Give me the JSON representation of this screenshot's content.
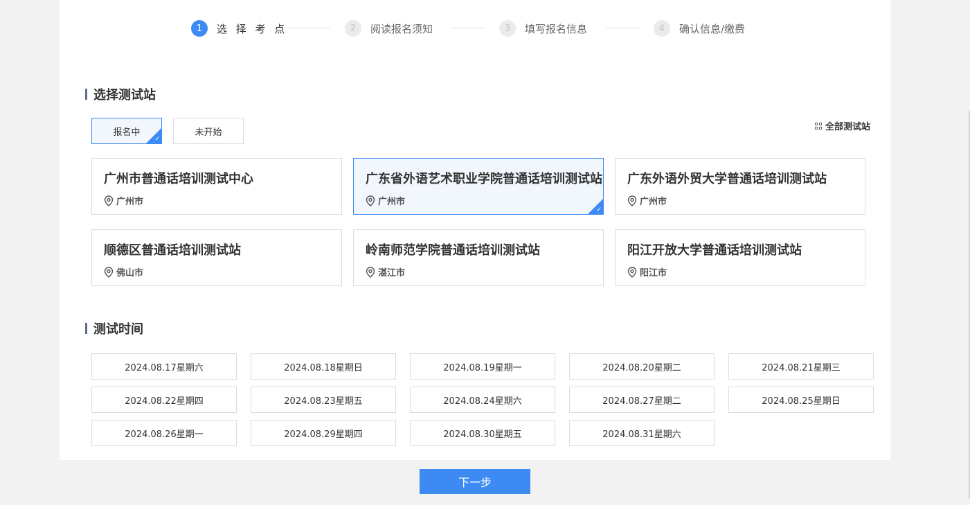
{
  "steps": [
    {
      "num": "1",
      "label": "选 择 考 点"
    },
    {
      "num": "2",
      "label": "阅读报名须知"
    },
    {
      "num": "3",
      "label": "填写报名信息"
    },
    {
      "num": "4",
      "label": "确认信息/缴费"
    }
  ],
  "site_section": {
    "title": "选择测试站",
    "filters": [
      "报名中",
      "未开始"
    ],
    "active_filter": "报名中",
    "all_sites_label": "全部测试站",
    "corner_check": "✓",
    "sites": [
      {
        "name": "广州市普通话培训测试中心",
        "city": "广州市"
      },
      {
        "name": "广东省外语艺术职业学院普通话培训测试站",
        "city": "广州市",
        "selected": true
      },
      {
        "name": "广东外语外贸大学普通话培训测试站",
        "city": "广州市"
      },
      {
        "name": "顺德区普通话培训测试站",
        "city": "佛山市"
      },
      {
        "name": "岭南师范学院普通话培训测试站",
        "city": "湛江市"
      },
      {
        "name": "阳江开放大学普通话培训测试站",
        "city": "阳江市"
      }
    ]
  },
  "time_section": {
    "title": "测试时间",
    "dates": [
      "2024.08.17星期六",
      "2024.08.18星期日",
      "2024.08.19星期一",
      "2024.08.20星期二",
      "2024.08.21星期三",
      "2024.08.22星期四",
      "2024.08.23星期五",
      "2024.08.24星期六",
      "2024.08.27星期二",
      "2024.08.25星期日",
      "2024.08.26星期一",
      "2024.08.29星期四",
      "2024.08.30星期五",
      "2024.08.31星期六"
    ]
  },
  "footer": {
    "next_label": "下一步"
  },
  "colors": {
    "accent": "#3d8bf2",
    "selected_bg": "#f2f6fd"
  }
}
